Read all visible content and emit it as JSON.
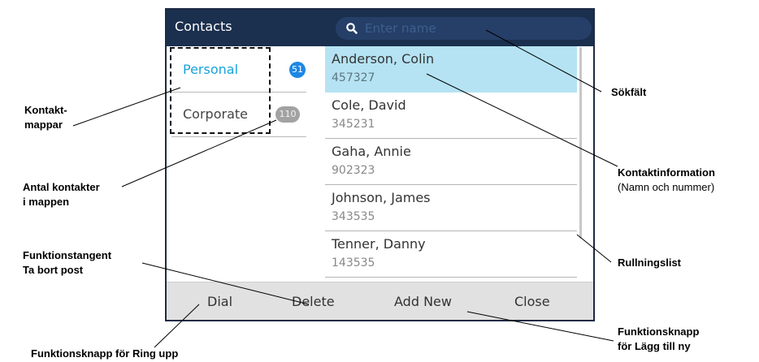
{
  "titlebar": {
    "title": "Contacts",
    "search_placeholder": "Enter name"
  },
  "folders": [
    {
      "label": "Personal",
      "count": "51",
      "active": true
    },
    {
      "label": "Corporate",
      "count": "110",
      "active": false
    }
  ],
  "contacts": [
    {
      "name": "Anderson, Colin",
      "number": "457327",
      "selected": true
    },
    {
      "name": "Cole, David",
      "number": "345231",
      "selected": false
    },
    {
      "name": "Gaha, Annie",
      "number": "902323",
      "selected": false
    },
    {
      "name": "Johnson, James",
      "number": "343535",
      "selected": false
    },
    {
      "name": "Tenner, Danny",
      "number": "143535",
      "selected": false
    }
  ],
  "softkeys": [
    "Dial",
    "Delete",
    "Add New",
    "Close"
  ],
  "callouts": {
    "folders": [
      "Kontakt-",
      "mappar"
    ],
    "count": [
      "Antal kontakter",
      "i mappen"
    ],
    "delete_key": [
      "Funktionstangent",
      "Ta bort post"
    ],
    "dial_key": "Funktionsknapp för Ring upp",
    "search": "Sökfält",
    "contact_info": "Kontaktinformation",
    "contact_info_sub": "(Namn och nummer)",
    "scrollbar": "Rullningslist",
    "addnew_key": [
      "Funktionsknapp",
      "för Lägg till ny"
    ]
  },
  "colors": {
    "titlebar": "#1b2f4e",
    "accent": "#19a3dc",
    "selected_row": "#b5e3f3",
    "softkey_bar": "#e1e1e1"
  }
}
